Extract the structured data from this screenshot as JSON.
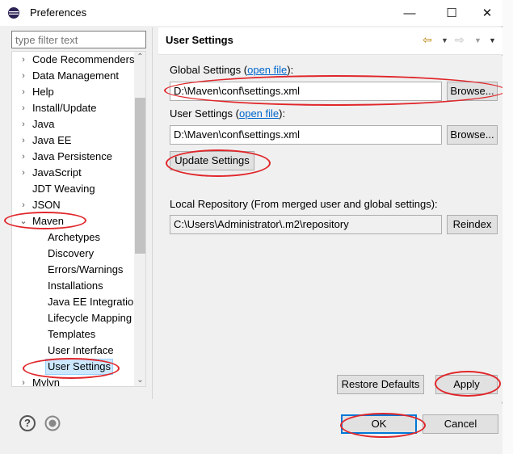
{
  "window": {
    "title": "Preferences",
    "minimize": "—",
    "maximize": "☐",
    "close": "✕"
  },
  "filter": {
    "placeholder": "type filter text"
  },
  "tree": {
    "items": [
      {
        "label": "Code Recommenders",
        "arrow": "›"
      },
      {
        "label": "Data Management",
        "arrow": "›"
      },
      {
        "label": "Help",
        "arrow": "›"
      },
      {
        "label": "Install/Update",
        "arrow": "›"
      },
      {
        "label": "Java",
        "arrow": "›"
      },
      {
        "label": "Java EE",
        "arrow": "›"
      },
      {
        "label": "Java Persistence",
        "arrow": "›"
      },
      {
        "label": "JavaScript",
        "arrow": "›"
      },
      {
        "label": "JDT Weaving",
        "arrow": ""
      },
      {
        "label": "JSON",
        "arrow": "›"
      },
      {
        "label": "Maven",
        "arrow": "⌄"
      }
    ],
    "maven_children": [
      "Archetypes",
      "Discovery",
      "Errors/Warnings",
      "Installations",
      "Java EE Integration",
      "Lifecycle Mapping",
      "Templates",
      "User Interface",
      "User Settings"
    ],
    "after": {
      "label": "Mylyn",
      "arrow": "›"
    },
    "scroll_up": "⌃",
    "scroll_down": "⌄"
  },
  "page": {
    "title": "User Settings",
    "nav_back": "⇦",
    "nav_forward": "⇨",
    "dropdown": "▼",
    "global_settings_label": "Global Settings (",
    "global_open_file": "open file",
    "global_settings_suffix": "):",
    "global_settings_value": "D:\\Maven\\conf\\settings.xml",
    "user_settings_label": "User Settings (",
    "user_open_file": "open file",
    "user_settings_suffix": "):",
    "user_settings_value": "D:\\Maven\\conf\\settings.xml",
    "browse_label": "Browse...",
    "update_settings_label": "Update Settings",
    "local_repo_label": "Local Repository (From merged user and global settings):",
    "local_repo_value": "C:\\Users\\Administrator\\.m2\\repository",
    "reindex_label": "Reindex",
    "restore_defaults_label": "Restore Defaults",
    "apply_label": "Apply"
  },
  "footer": {
    "help_icon": "?",
    "ok_label": "OK",
    "cancel_label": "Cancel"
  },
  "colors": {
    "annotation": "#e0262a",
    "link": "#0066cc",
    "selection": "#cce8ff"
  }
}
